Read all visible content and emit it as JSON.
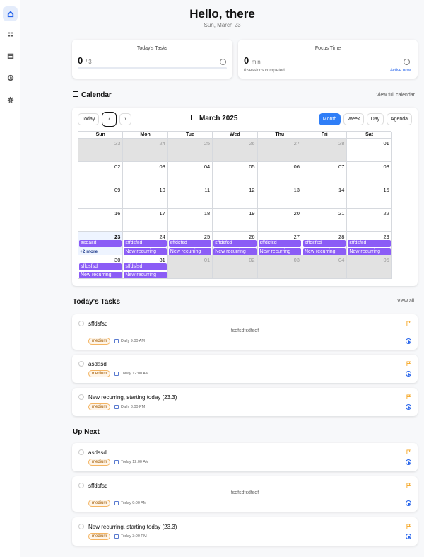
{
  "header": {
    "greeting": "Hello, there",
    "date": "Sun, March 23"
  },
  "stats": {
    "tasks": {
      "title": "Today's Tasks",
      "value": "0",
      "total": "/ 3",
      "progress": 0
    },
    "focus": {
      "title": "Focus Time",
      "value": "0",
      "unit": "min",
      "sessions": "0 sessions completed",
      "status": "Active now"
    }
  },
  "calendar": {
    "title": "Calendar",
    "view_full": "View full calendar",
    "today_btn": "Today",
    "prev": "‹",
    "next": "›",
    "month_label": "March 2025",
    "views": [
      "Month",
      "Week",
      "Day",
      "Agenda"
    ],
    "active_view": "Month",
    "dow": [
      "Sun",
      "Mon",
      "Tue",
      "Wed",
      "Thu",
      "Fri",
      "Sat"
    ],
    "weeks": [
      [
        "23",
        "24",
        "25",
        "26",
        "27",
        "28",
        "01"
      ],
      [
        "02",
        "03",
        "04",
        "05",
        "06",
        "07",
        "08"
      ],
      [
        "09",
        "10",
        "11",
        "12",
        "13",
        "14",
        "15"
      ],
      [
        "16",
        "17",
        "18",
        "19",
        "20",
        "21",
        "22"
      ],
      [
        "23",
        "24",
        "25",
        "26",
        "27",
        "28",
        "29"
      ],
      [
        "30",
        "31",
        "01",
        "02",
        "03",
        "04",
        "05"
      ]
    ],
    "events_week5": [
      [
        "asdasd"
      ],
      [
        "sffdsfsd",
        "New recurring"
      ],
      [
        "sffdsfsd",
        "New recurring"
      ],
      [
        "sffdsfsd",
        "New recurring"
      ],
      [
        "sffdsfsd",
        "New recurring"
      ],
      [
        "sffdsfsd",
        "New recurring"
      ],
      [
        "sffdsfsd",
        "New recurring"
      ]
    ],
    "more_label": "+2 more",
    "events_week6": [
      [
        "sffdsfsd",
        "New recurring"
      ],
      [
        "sffdsfsd",
        "New recurring"
      ]
    ]
  },
  "today_tasks": {
    "title": "Today's Tasks",
    "view_all": "View all",
    "items": [
      {
        "title": "sffdsfsd",
        "desc": "fsdfsdfsdfsdf",
        "priority": "medium",
        "when": "Daily 9:00 AM"
      },
      {
        "title": "asdasd",
        "desc": "",
        "priority": "medium",
        "when": "Today 12:00 AM"
      },
      {
        "title": "New recurring, starting today (23.3)",
        "desc": "",
        "priority": "medium",
        "when": "Daily 3:00 PM"
      }
    ]
  },
  "up_next": {
    "title": "Up Next",
    "items": [
      {
        "title": "asdasd",
        "desc": "",
        "priority": "medium",
        "when": "Today 12:00 AM"
      },
      {
        "title": "sffdsfsd",
        "desc": "fsdfsdfsdfsdf",
        "priority": "medium",
        "when": "Today 9:00 AM"
      },
      {
        "title": "New recurring, starting today (23.3)",
        "desc": "",
        "priority": "medium",
        "when": "Today 3:00 PM"
      }
    ]
  },
  "colors": {
    "accent": "#2f7ef7",
    "event": "#8b5cf6",
    "priority": "#f4b461"
  },
  "sidebar": {
    "icons": [
      "home-icon",
      "tasks-icon",
      "calendar-icon",
      "clock-icon",
      "gear-icon"
    ]
  }
}
